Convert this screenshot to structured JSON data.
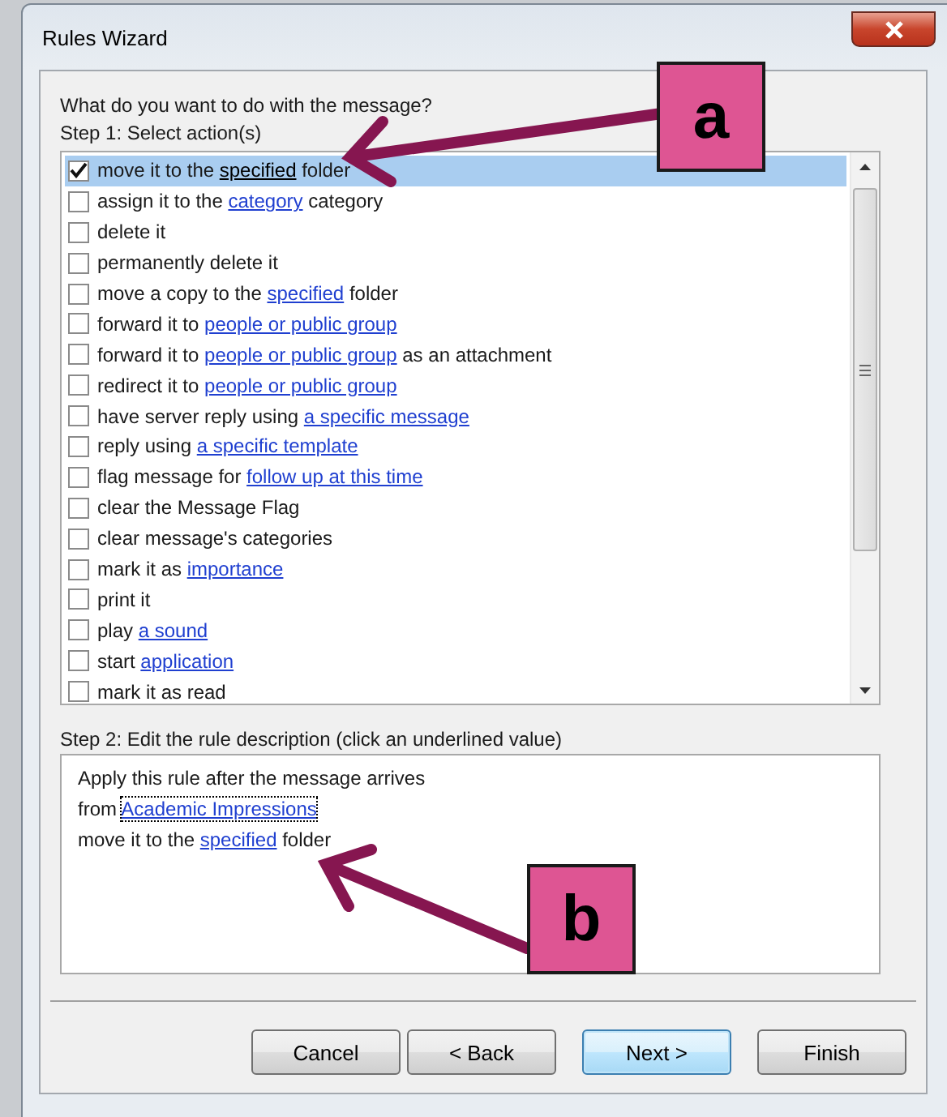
{
  "window": {
    "title": "Rules Wizard"
  },
  "prompt": "What do you want to do with the message?",
  "step1": "Step 1: Select action(s)",
  "actions": [
    {
      "checked": true,
      "selected": true,
      "segments": [
        {
          "text": "move it to the "
        },
        {
          "text": "specified",
          "link": true
        },
        {
          "text": " folder"
        }
      ]
    },
    {
      "checked": false,
      "selected": false,
      "segments": [
        {
          "text": "assign it to the "
        },
        {
          "text": "category",
          "link": true
        },
        {
          "text": " category"
        }
      ]
    },
    {
      "checked": false,
      "selected": false,
      "segments": [
        {
          "text": "delete it"
        }
      ]
    },
    {
      "checked": false,
      "selected": false,
      "segments": [
        {
          "text": "permanently delete it"
        }
      ]
    },
    {
      "checked": false,
      "selected": false,
      "segments": [
        {
          "text": "move a copy to the "
        },
        {
          "text": "specified",
          "link": true
        },
        {
          "text": " folder"
        }
      ]
    },
    {
      "checked": false,
      "selected": false,
      "segments": [
        {
          "text": "forward it to "
        },
        {
          "text": "people or public group",
          "link": true
        }
      ]
    },
    {
      "checked": false,
      "selected": false,
      "segments": [
        {
          "text": "forward it to "
        },
        {
          "text": "people or public group",
          "link": true
        },
        {
          "text": " as an attachment"
        }
      ]
    },
    {
      "checked": false,
      "selected": false,
      "segments": [
        {
          "text": "redirect it to "
        },
        {
          "text": "people or public group",
          "link": true
        }
      ]
    },
    {
      "checked": false,
      "selected": false,
      "segments": [
        {
          "text": "have server reply using "
        },
        {
          "text": "a specific message",
          "link": true
        }
      ]
    },
    {
      "checked": false,
      "selected": false,
      "segments": [
        {
          "text": "reply using "
        },
        {
          "text": "a specific template",
          "link": true
        }
      ]
    },
    {
      "checked": false,
      "selected": false,
      "segments": [
        {
          "text": "flag message for "
        },
        {
          "text": "follow up at this time",
          "link": true
        }
      ]
    },
    {
      "checked": false,
      "selected": false,
      "segments": [
        {
          "text": "clear the Message Flag"
        }
      ]
    },
    {
      "checked": false,
      "selected": false,
      "segments": [
        {
          "text": "clear message's categories"
        }
      ]
    },
    {
      "checked": false,
      "selected": false,
      "segments": [
        {
          "text": "mark it as "
        },
        {
          "text": "importance",
          "link": true
        }
      ]
    },
    {
      "checked": false,
      "selected": false,
      "segments": [
        {
          "text": "print it"
        }
      ]
    },
    {
      "checked": false,
      "selected": false,
      "segments": [
        {
          "text": "play "
        },
        {
          "text": "a sound",
          "link": true
        }
      ]
    },
    {
      "checked": false,
      "selected": false,
      "segments": [
        {
          "text": "start "
        },
        {
          "text": "application",
          "link": true
        }
      ]
    },
    {
      "checked": false,
      "selected": false,
      "segments": [
        {
          "text": "mark it as read"
        }
      ]
    }
  ],
  "step2": "Step 2: Edit the rule description (click an underlined value)",
  "description": [
    {
      "segments": [
        {
          "text": "Apply this rule after the message arrives"
        }
      ]
    },
    {
      "segments": [
        {
          "text": "from "
        },
        {
          "text": "Academic Impressions",
          "link": true,
          "focused": true
        }
      ]
    },
    {
      "segments": [
        {
          "text": "move it to the "
        },
        {
          "text": "specified",
          "link": true,
          "focused": false
        },
        {
          "text": " folder"
        }
      ]
    }
  ],
  "buttons": [
    {
      "label": "Cancel",
      "default": false
    },
    {
      "label": "< Back",
      "default": false
    },
    {
      "label": "Next >",
      "default": true
    },
    {
      "label": "Finish",
      "default": false
    }
  ],
  "callouts": [
    {
      "label": "a"
    },
    {
      "label": "b"
    }
  ]
}
